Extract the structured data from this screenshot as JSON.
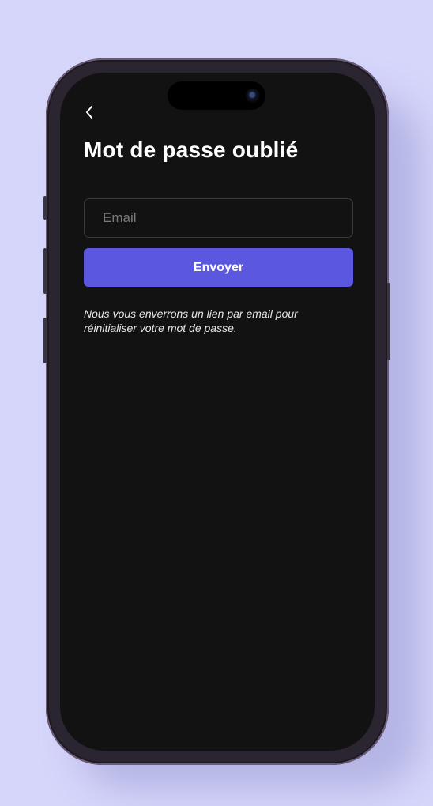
{
  "screen": {
    "title": "Mot de passe oublié",
    "email": {
      "value": "",
      "placeholder": "Email"
    },
    "submit_label": "Envoyer",
    "helper_text": "Nous vous enverrons un lien par email pour réinitialiser votre mot de passe."
  },
  "icons": {
    "back": "chevron-left-icon"
  },
  "colors": {
    "background": "#d6d6fb",
    "screen": "#121212",
    "accent": "#5b57df",
    "text": "#ffffff",
    "placeholder": "#7b7b7b"
  }
}
